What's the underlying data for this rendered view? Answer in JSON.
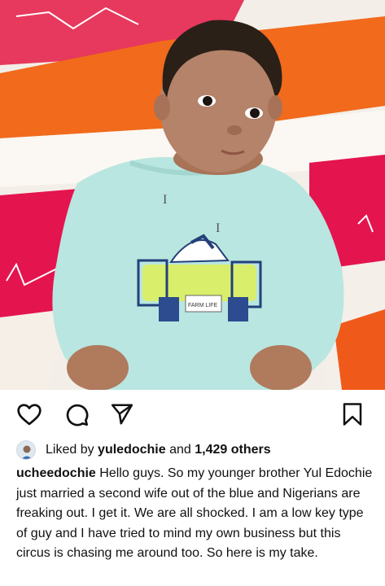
{
  "post": {
    "photo_alt": "baby-photo",
    "likes": {
      "prefix": "Liked by",
      "liker": "yuledochie",
      "joiner": "and",
      "count_text": "1,429 others"
    },
    "caption": {
      "username": "ucheedochie",
      "text": "Hello guys. So my younger brother Yul Edochie just married a second wife out of the blue and Nigerians are freaking out. I get it. We are all shocked. I am a low key type of guy and I have tried to mind my own business but this circus is chasing me around too. So here is my take."
    },
    "shirt_print": {
      "letter_i": "I",
      "farm_life": "FARM LIFE"
    }
  },
  "icons": {
    "like": "heart-icon",
    "comment": "comment-bubble-icon",
    "share": "paper-plane-icon",
    "save": "bookmark-icon"
  },
  "colors": {
    "text": "#111111",
    "shirt": "#b9e6e0",
    "pillow_orange": "#f26a1c",
    "pillow_pink": "#e4144e"
  }
}
